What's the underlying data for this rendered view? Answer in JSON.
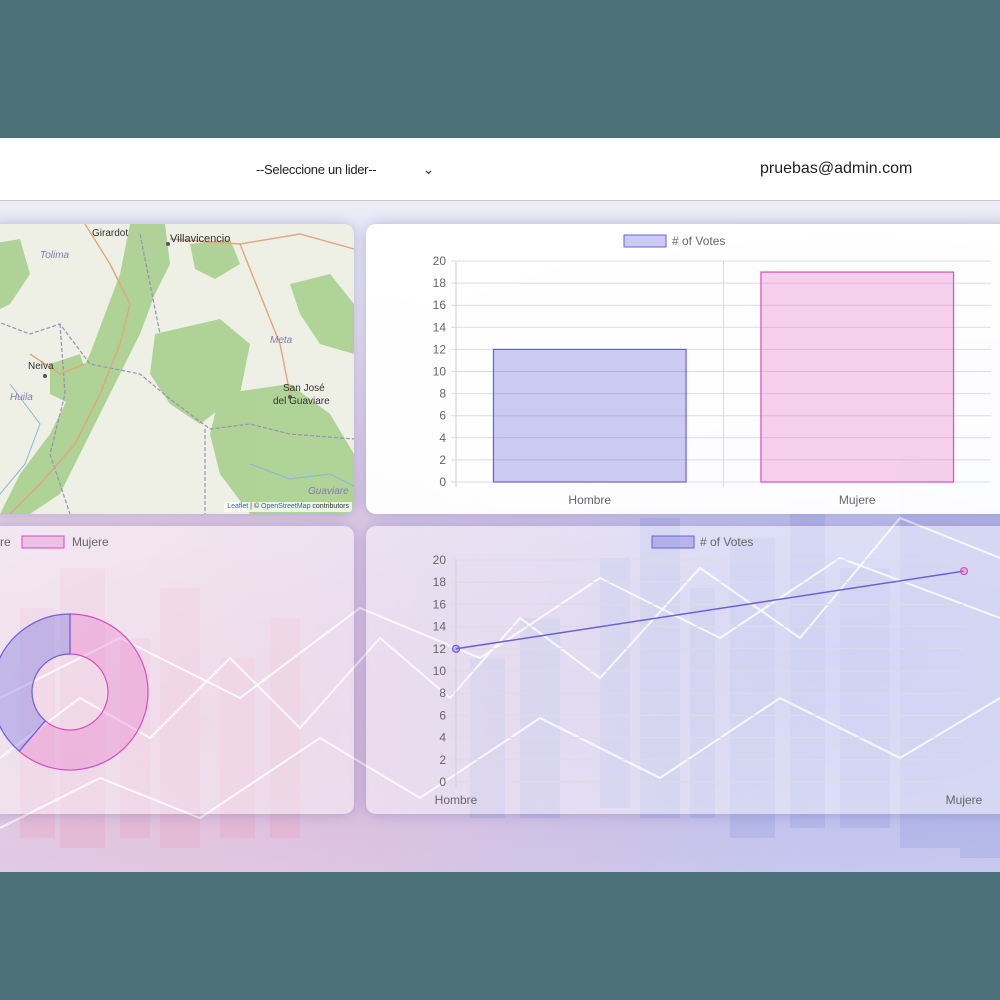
{
  "topbar": {
    "leader_select": {
      "selected": "--Seleccione un lider--",
      "icon": "chevron-down-icon"
    },
    "user_email": "pruebas@admin.com"
  },
  "colors": {
    "page_frame": "#4b7078",
    "series_blue_fill": "rgba(110,105,220,0.35)",
    "series_blue_border": "#6b5fe0",
    "series_pink_fill": "rgba(230,120,200,0.35)",
    "series_pink_border": "#d84cc4"
  },
  "map": {
    "labels": [
      "Girardot",
      "Villavicencio",
      "Tolima",
      "Meta",
      "Neiva",
      "San José",
      "del Guaviare",
      "Huila",
      "Guaviare"
    ],
    "attribution": {
      "leaflet": "Leaflet",
      "separator": " | © ",
      "osm": "OpenStreetMap",
      "suffix": " contributors"
    }
  },
  "chart_data": [
    {
      "type": "bar",
      "categories": [
        "Hombre",
        "Mujere"
      ],
      "series": [
        {
          "name": "# of Votes",
          "values": [
            12,
            19
          ]
        }
      ],
      "bar_colors": [
        "series_blue",
        "series_pink"
      ],
      "ylim": [
        0,
        20
      ],
      "yticks": [
        0,
        2,
        4,
        6,
        8,
        10,
        12,
        14,
        16,
        18,
        20
      ],
      "legend": "top",
      "grid": true
    },
    {
      "type": "pie",
      "donut": true,
      "categories": [
        "Hombre",
        "Mujere"
      ],
      "values": [
        12,
        19
      ],
      "legend_visible": [
        "re",
        "Mujere"
      ],
      "legend": "top"
    },
    {
      "type": "line",
      "categories": [
        "Hombre",
        "Mujere"
      ],
      "series": [
        {
          "name": "# of Votes",
          "values": [
            12,
            19
          ]
        }
      ],
      "ylim": [
        0,
        20
      ],
      "yticks": [
        0,
        2,
        4,
        6,
        8,
        10,
        12,
        14,
        16,
        18,
        20
      ],
      "legend": "top",
      "grid": true
    }
  ]
}
